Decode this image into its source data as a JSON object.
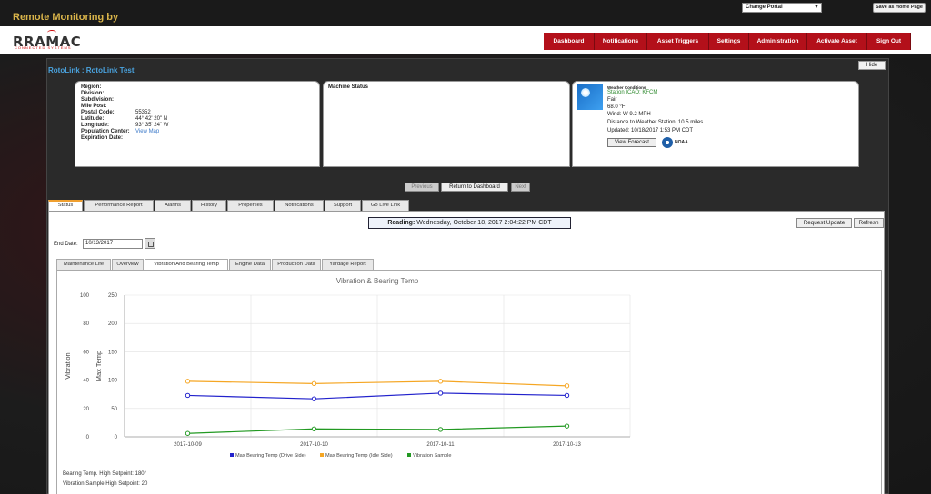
{
  "topbar": {
    "brand_title": "Remote Monitoring by",
    "portal_select": "Change Portal",
    "home_button": "Save as Home Page"
  },
  "logo": {
    "text": "RRAMAC",
    "sub": "CONNECTED SYSTEMS"
  },
  "nav": {
    "items": [
      {
        "label": "Dashboard"
      },
      {
        "label": "Notifications"
      },
      {
        "label": "Asset Triggers"
      },
      {
        "label": "Settings"
      },
      {
        "label": "Administration"
      },
      {
        "label": "Activate Asset"
      },
      {
        "label": "Sign Out"
      }
    ]
  },
  "asset": {
    "title": "RotoLink : RotoLink Test",
    "hide_label": "Hide",
    "info": {
      "region": {
        "label": "Region:",
        "value": ""
      },
      "division": {
        "label": "Division:",
        "value": ""
      },
      "subdivision": {
        "label": "Subdivision:",
        "value": ""
      },
      "mile_post": {
        "label": "Mile Post:",
        "value": ""
      },
      "postal_code": {
        "label": "Postal Code:",
        "value": "55352"
      },
      "latitude": {
        "label": "Latitude:",
        "value": "44° 42' 20\" N"
      },
      "longitude": {
        "label": "Longitude:",
        "value": "93° 35' 24\" W"
      },
      "population_center": {
        "label": "Population Center:",
        "value": "View Map"
      },
      "expiration_date": {
        "label": "Expiration Date:",
        "value": ""
      }
    },
    "machine_status_title": "Machine Status",
    "weather": {
      "heading": "Weather Conditions",
      "station": "Station ICAO: KFCM",
      "condition": "Fair",
      "temperature": "68.0 °F",
      "wind": "Wind: W 9.2 MPH",
      "distance": "Distance to Weather Station: 10.5 miles",
      "updated": "Updated: 10/18/2017 1:53 PM CDT",
      "forecast_button": "View Forecast",
      "noaa_label": "NOAA"
    }
  },
  "pager": {
    "previous": "Previous",
    "return": "Return to Dashboard",
    "next": "Next"
  },
  "tabs": [
    {
      "label": "Status",
      "active": true
    },
    {
      "label": "Performance Report"
    },
    {
      "label": "Alarms"
    },
    {
      "label": "History"
    },
    {
      "label": "Properties"
    },
    {
      "label": "Notifications"
    },
    {
      "label": "Support"
    },
    {
      "label": "Go Live Link"
    }
  ],
  "status": {
    "reading_label": "Reading:",
    "reading_value": "Wednesday, October 18, 2017 2:04:22 PM CDT",
    "request_update": "Request Update",
    "refresh": "Refresh",
    "end_date_label": "End Date:",
    "end_date_value": "10/13/2017"
  },
  "subtabs": [
    {
      "label": "Maintenance Life"
    },
    {
      "label": "Overview"
    },
    {
      "label": "Vibration And Bearing Temp",
      "active": true
    },
    {
      "label": "Engine Data"
    },
    {
      "label": "Production Data"
    },
    {
      "label": "Yardage Report"
    }
  ],
  "chart_data": {
    "type": "line",
    "title": "Vibration & Bearing Temp",
    "categories": [
      "2017-10-09",
      "2017-10-10",
      "2017-10-11",
      "2017-10-13"
    ],
    "y_left": {
      "label": "Vibration",
      "range": [
        0,
        100
      ],
      "ticks": [
        0,
        20,
        40,
        60,
        80,
        100
      ]
    },
    "y_right": {
      "label": "Max Temp",
      "range": [
        0,
        250
      ],
      "ticks": [
        0,
        50,
        100,
        150,
        200,
        250
      ]
    },
    "series": [
      {
        "name": "Max Bearing Temp (Drive Side)",
        "color": "#2222cc",
        "axis": "right",
        "values": [
          73,
          67,
          77,
          73
        ]
      },
      {
        "name": "Max Bearing Temp (Idle Side)",
        "color": "#f5a623",
        "axis": "right",
        "values": [
          98,
          94,
          98,
          90
        ]
      },
      {
        "name": "Vibration Sample",
        "color": "#229922",
        "axis": "right",
        "values": [
          6,
          14,
          13,
          19
        ]
      }
    ],
    "grid": true,
    "legend": "bottom"
  },
  "setpoints": {
    "bearing": "Bearing Temp. High Setpoint: 180°",
    "vibration": "Vibration Sample High Setpoint: 20"
  }
}
